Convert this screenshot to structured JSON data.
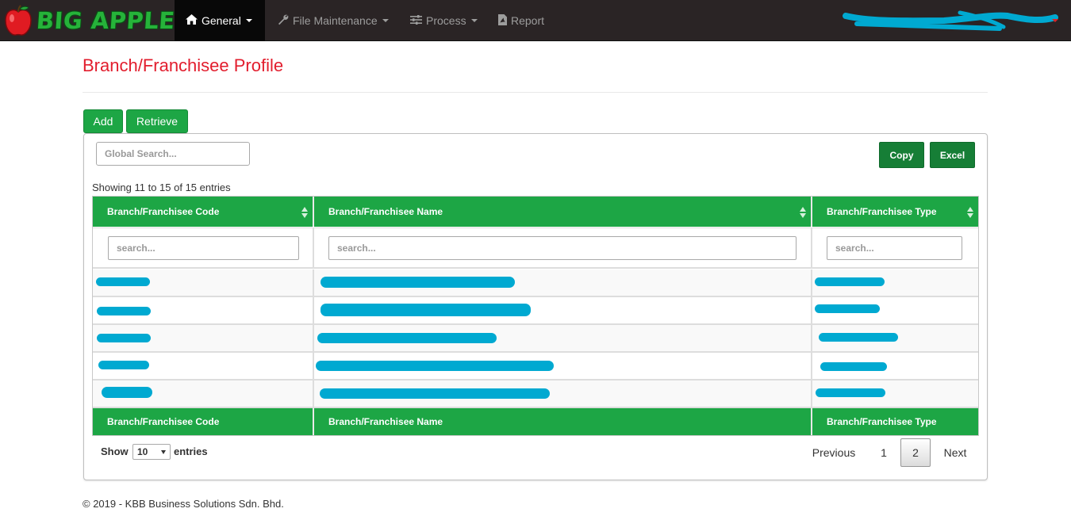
{
  "navbar": {
    "brand": "BIG APPLE",
    "items": [
      {
        "label": "General",
        "icon": "home-icon",
        "active": true
      },
      {
        "label": "File Maintenance",
        "icon": "wrench-icon",
        "active": false
      },
      {
        "label": "Process",
        "icon": "sliders-icon",
        "active": false
      },
      {
        "label": "Report",
        "icon": "pdf-icon",
        "active": false
      }
    ]
  },
  "page": {
    "title": "Branch/Franchisee Profile",
    "add_label": "Add",
    "retrieve_label": "Retrieve"
  },
  "table_tools": {
    "global_search_placeholder": "Global Search...",
    "copy_label": "Copy",
    "excel_label": "Excel",
    "showing": "Showing 11 to 15 of 15 entries"
  },
  "table": {
    "columns": [
      "Branch/Franchisee Code",
      "Branch/Franchisee Name",
      "Branch/Franchisee Type"
    ],
    "column_search_placeholder": "search...",
    "footer_columns": [
      "Branch/Franchisee Code",
      "Branch/Franchisee Name",
      "Branch/Franchisee Type"
    ]
  },
  "paging": {
    "show_label": "Show",
    "page_size": "10",
    "entries_label": "entries",
    "previous": "Previous",
    "pages": [
      "1",
      "2"
    ],
    "current_page": "2",
    "next": "Next"
  },
  "footer": {
    "copyright": "© 2019 - KBB Business Solutions Sdn. Bhd."
  },
  "colors": {
    "navbar_bg": "#2a2425",
    "accent_green": "#1da645",
    "dark_green": "#167e36",
    "title_red": "#e21d2d",
    "redaction_blue": "#00a9d1"
  }
}
